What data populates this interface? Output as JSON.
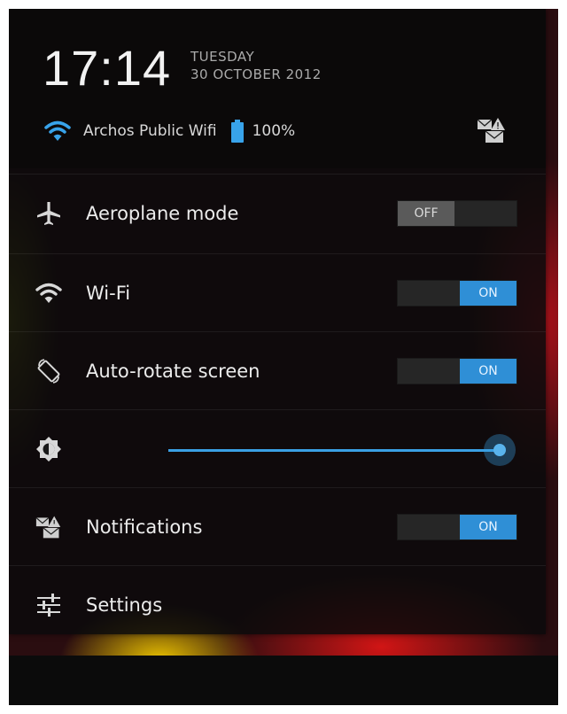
{
  "header": {
    "time": "17:14",
    "day": "TUESDAY",
    "date": "30 OCTOBER 2012",
    "network_name": "Archos Public Wifi",
    "battery": "100%"
  },
  "rows": {
    "aeroplane": {
      "label": "Aeroplane mode",
      "state": "OFF"
    },
    "wifi": {
      "label": "Wi-Fi",
      "state": "ON"
    },
    "autorotate": {
      "label": "Auto-rotate screen",
      "state": "ON"
    },
    "brightness": {
      "level": 1.0
    },
    "notifications": {
      "label": "Notifications",
      "state": "ON"
    },
    "settings": {
      "label": "Settings"
    }
  },
  "colors": {
    "accent": "#2f8fd6",
    "panel": "#0a0a0c",
    "text": "#ececec"
  },
  "icons": {
    "wifi": "wifi-icon",
    "battery": "battery-icon",
    "notifications": "notifications-icon",
    "aeroplane": "airplane-icon",
    "autorotate": "rotate-icon",
    "brightness": "brightness-icon",
    "settings": "settings-sliders-icon"
  }
}
